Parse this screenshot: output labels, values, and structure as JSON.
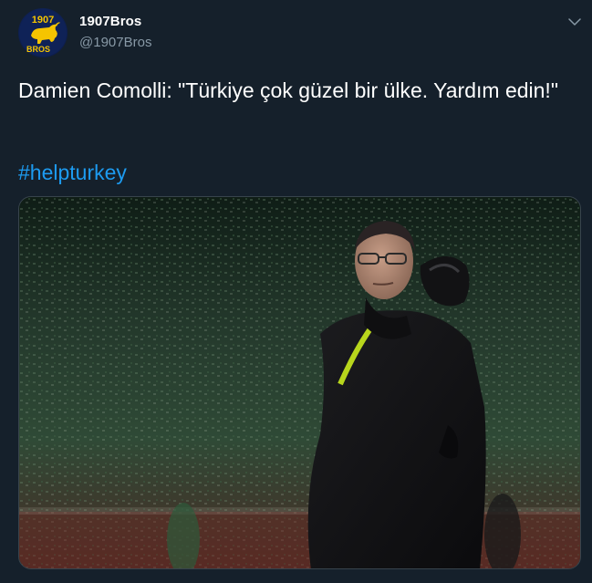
{
  "author": {
    "display_name": "1907Bros",
    "handle": "@1907Bros",
    "avatar_text_top": "1907",
    "avatar_text_bottom": "BROS"
  },
  "tweet": {
    "text": "Damien Comolli: \"Türkiye çok güzel bir ülke. Yardım edin!\"",
    "hashtag": "#helpturkey"
  },
  "media": {
    "description_icon": "photo"
  },
  "colors": {
    "background": "#15202b",
    "link": "#1d9bf0",
    "muted": "#8899a6",
    "border": "#38444d"
  }
}
